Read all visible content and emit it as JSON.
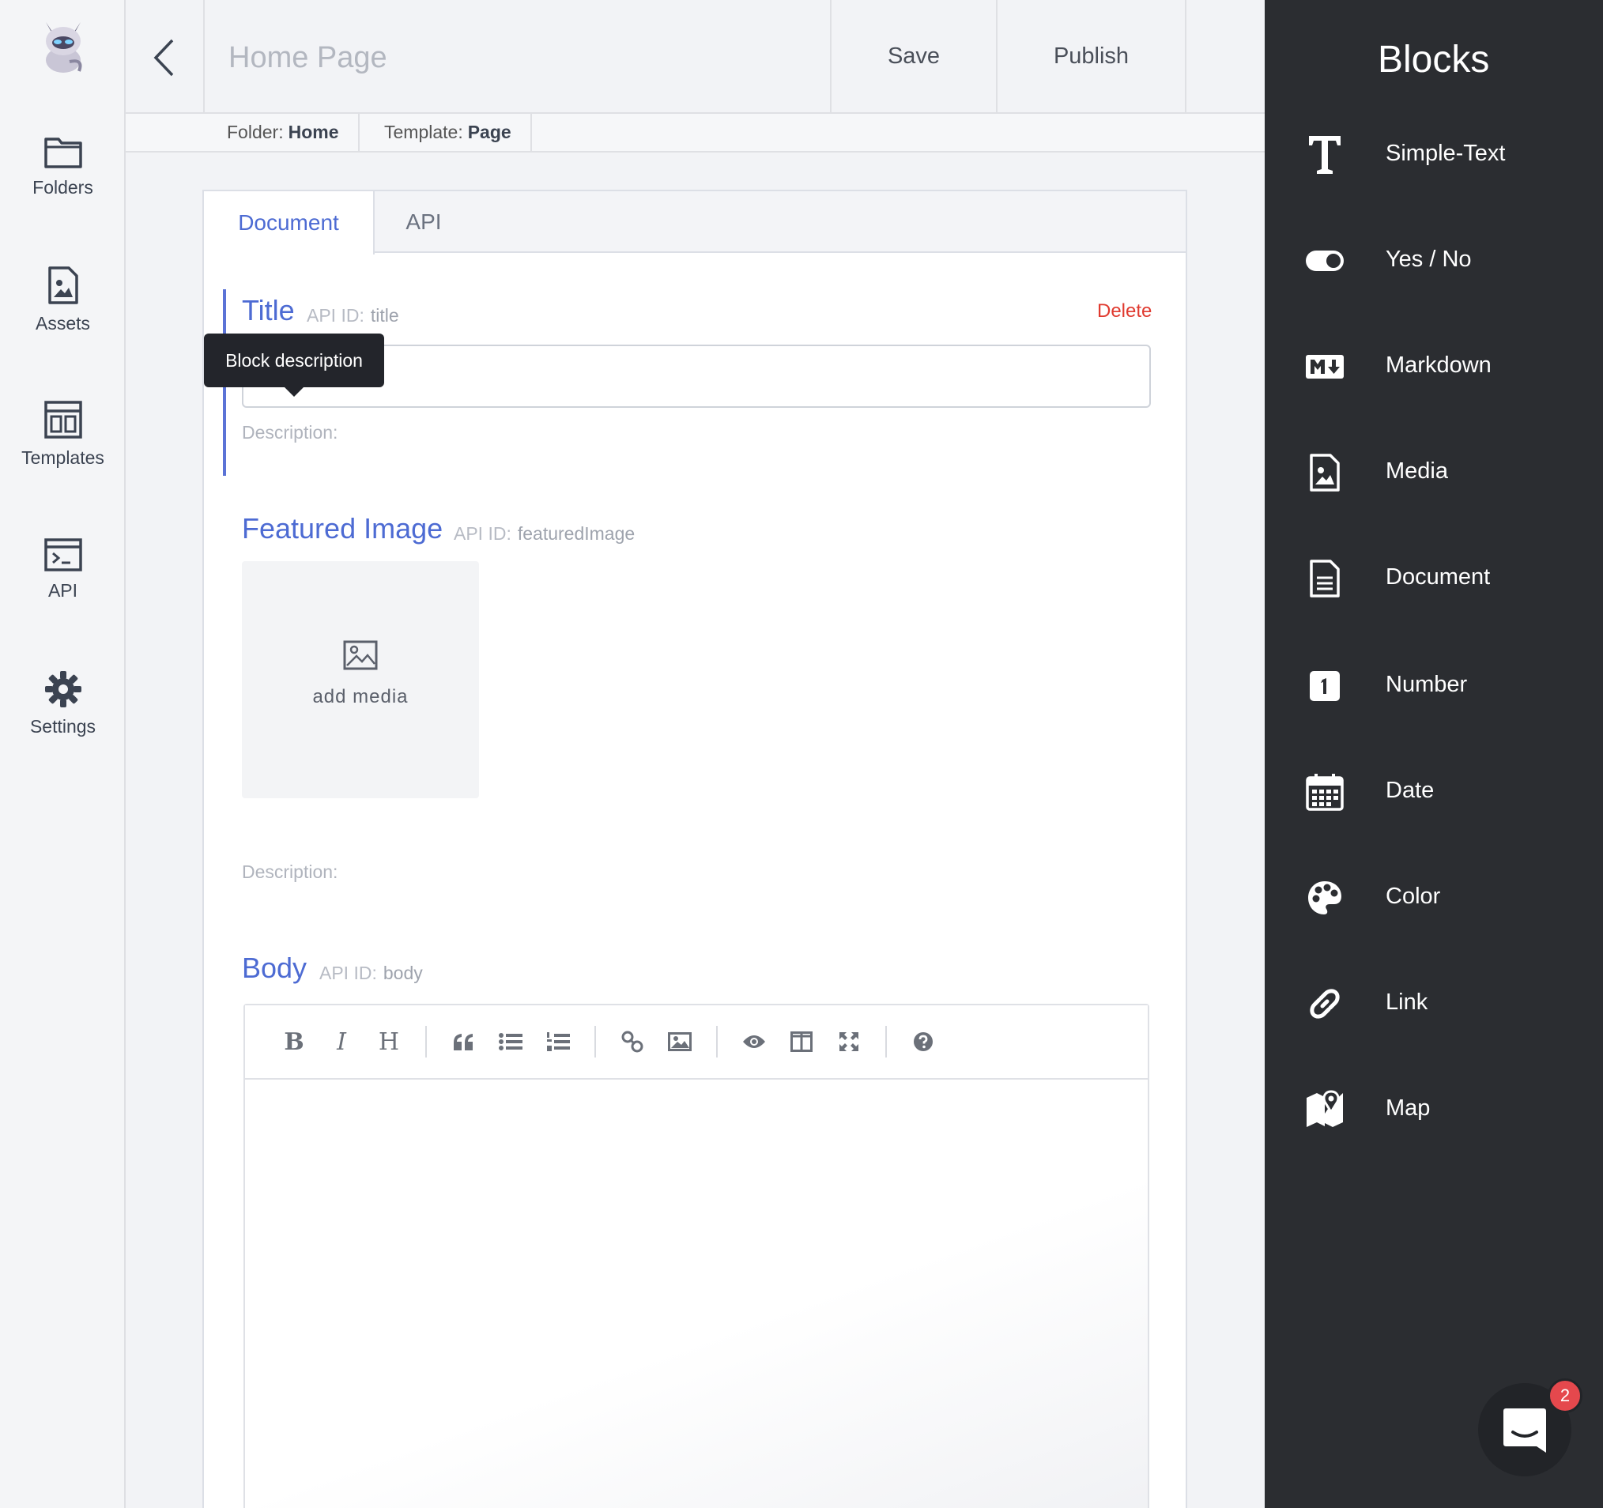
{
  "nav": {
    "items": [
      {
        "label": "Folders",
        "icon": "folder-icon"
      },
      {
        "label": "Assets",
        "icon": "image-file-icon"
      },
      {
        "label": "Templates",
        "icon": "template-icon"
      },
      {
        "label": "API",
        "icon": "terminal-icon"
      },
      {
        "label": "Settings",
        "icon": "gear-icon"
      }
    ]
  },
  "header": {
    "title": "Home Page",
    "save_label": "Save",
    "publish_label": "Publish"
  },
  "meta": {
    "folder_label": "Folder:",
    "folder_value": "Home",
    "template_label": "Template:",
    "template_value": "Page"
  },
  "tabs": [
    {
      "label": "Document",
      "active": true
    },
    {
      "label": "API",
      "active": false
    }
  ],
  "fields": {
    "title": {
      "label": "Title",
      "api_id_label": "API ID:",
      "api_id": "title",
      "delete_label": "Delete",
      "value": "",
      "description_label": "Description:",
      "tooltip": "Block description"
    },
    "featured_image": {
      "label": "Featured Image",
      "api_id_label": "API ID:",
      "api_id": "featuredImage",
      "add_media_label": "add media",
      "description_label": "Description:"
    },
    "body": {
      "label": "Body",
      "api_id_label": "API ID:",
      "api_id": "body",
      "toolbar": {
        "bold": "B",
        "italic": "I",
        "heading": "H"
      }
    }
  },
  "blocks": {
    "title": "Blocks",
    "items": [
      {
        "label": "Simple-Text",
        "icon": "text-icon"
      },
      {
        "label": "Yes / No",
        "icon": "toggle-icon"
      },
      {
        "label": "Markdown",
        "icon": "markdown-icon"
      },
      {
        "label": "Media",
        "icon": "image-file-icon"
      },
      {
        "label": "Document",
        "icon": "document-icon"
      },
      {
        "label": "Number",
        "icon": "number-icon"
      },
      {
        "label": "Date",
        "icon": "calendar-icon"
      },
      {
        "label": "Color",
        "icon": "palette-icon"
      },
      {
        "label": "Link",
        "icon": "link-icon"
      },
      {
        "label": "Map",
        "icon": "map-icon"
      }
    ]
  },
  "chat": {
    "badge_count": "2"
  },
  "colors": {
    "accent": "#4d6bd3",
    "danger": "#e03a2f",
    "panel_dark": "#2b2d31"
  }
}
